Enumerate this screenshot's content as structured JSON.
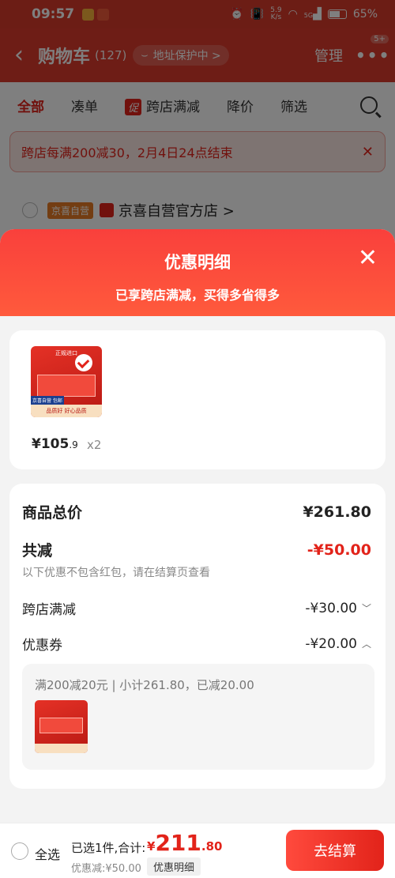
{
  "status": {
    "time": "09:57",
    "net_speed": "5.9",
    "net_unit": "K/s",
    "signal": "5G",
    "battery": "65%"
  },
  "header": {
    "title": "购物车",
    "count": "(127)",
    "address_protect": "地址保护中 >",
    "manage": "管理",
    "more_badge": "5+"
  },
  "tabs": [
    {
      "label": "全部"
    },
    {
      "label": "凑单"
    },
    {
      "label": "跨店满减",
      "icon_text": "促"
    },
    {
      "label": "降价"
    },
    {
      "label": "筛选"
    }
  ],
  "banner": {
    "text": "跨店每满200减30，2月4日24点结束"
  },
  "store": {
    "tag": "京喜自营",
    "name": "京喜自营官方店 >"
  },
  "sheet": {
    "title": "优惠明细",
    "subtitle": "已享跨店满减，买得多省得多",
    "product": {
      "price_main": "¥105",
      "price_decimal": ".9",
      "qty": "x2",
      "img_top": "正规进口",
      "img_bar": "品质好 好心品质",
      "img_tag": "京喜自营 包邮"
    },
    "total_label": "商品总价",
    "total_value": "¥261.80",
    "reduce_label": "共减",
    "reduce_value": "-¥50.00",
    "reduce_note": "以下优惠不包含红包，请在结算页查看",
    "items": [
      {
        "label": "跨店满减",
        "value": "-¥30.00",
        "chevron": "﹀"
      },
      {
        "label": "优惠券",
        "value": "-¥20.00",
        "chevron": "︿"
      }
    ],
    "coupon_detail": "满200减20元 | 小计261.80，已减20.00"
  },
  "bottom": {
    "select_all": "全选",
    "selected": "已选1件,合计:",
    "currency": "¥",
    "total_int": "211",
    "total_dec": ".80",
    "discount": "优惠减:¥50.00",
    "detail_btn": "优惠明细",
    "checkout": "去结算"
  },
  "colors": {
    "brand_red": "#e2231a",
    "header_red": "#dd3b2c",
    "tag_orange": "#e77b24"
  }
}
